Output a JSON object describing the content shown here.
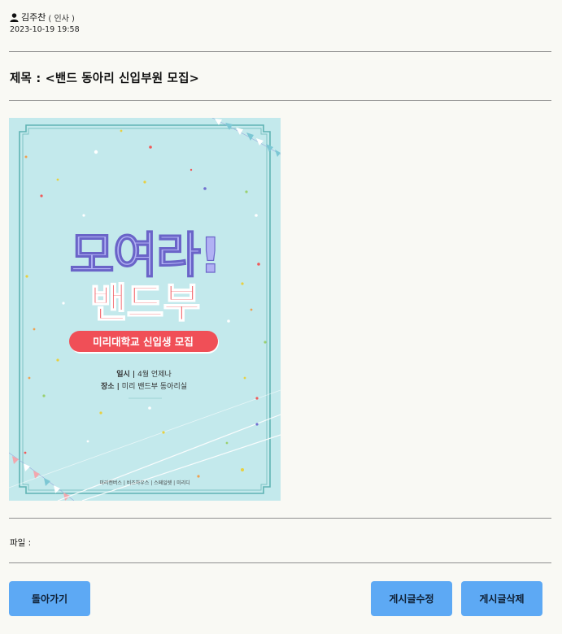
{
  "author": {
    "name": "김주찬",
    "dept": "( 인사 )",
    "icon": "user-icon"
  },
  "post": {
    "date": "2023-10-19 19:58",
    "title": "제목 : <밴드 동아리 신입부원 모집>",
    "file_label": "파일 :"
  },
  "poster": {
    "headline1": "모여라!",
    "headline2": "밴드부",
    "banner": "미리대학교 신입생 모집",
    "when_label": "일시 |",
    "when_value": " 4월 언제나",
    "place_label": "장소 |",
    "place_value": " 미리 밴드부 동아리실",
    "footer": "미리캔버스 | 비즈하우스 | 스페일렛 | 미리디",
    "colors": {
      "bg": "#c3e9ec",
      "headline1": "#b1b1f4",
      "headline2": "#f0565c",
      "banner": "#f04f57"
    }
  },
  "buttons": {
    "back": "돌아가기",
    "edit": "게시글수정",
    "delete": "게시글삭제"
  }
}
